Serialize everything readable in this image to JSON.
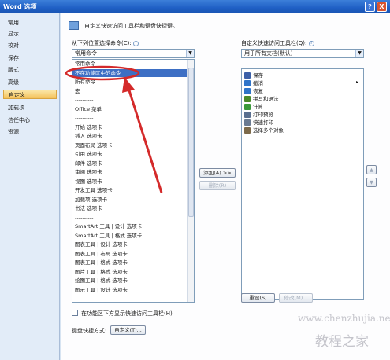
{
  "window": {
    "title": "Word 选项",
    "help_glyph": "?",
    "close_glyph": "X"
  },
  "sidebar": {
    "items": [
      {
        "label": "常用"
      },
      {
        "label": "显示"
      },
      {
        "label": "校对"
      },
      {
        "label": "保存"
      },
      {
        "label": "版式"
      },
      {
        "label": "高级"
      },
      {
        "label": "自定义",
        "active": true
      },
      {
        "label": "加载项"
      },
      {
        "label": "信任中心"
      },
      {
        "label": "资源"
      }
    ]
  },
  "main": {
    "header_text": "自定义快速访问工具栏和键盘快捷键。",
    "left_label": "从下列位置选择命令(C):",
    "left_dropdown_value": "常用命令",
    "right_label": "自定义快速访问工具栏(Q):",
    "right_dropdown_value": "用于所有文档(默认)",
    "commands_list": [
      "常用命令",
      "不在功能区中的命令",
      "所有命令",
      "宏",
      "----------",
      "Office 菜单",
      "----------",
      "开始 选项卡",
      "插入 选项卡",
      "页面布局 选项卡",
      "引用 选项卡",
      "邮件 选项卡",
      "审阅 选项卡",
      "视图 选项卡",
      "开发工具 选项卡",
      "加载项 选项卡",
      "书法 选项卡",
      "----------",
      "SmartArt 工具 | 设计 选项卡",
      "SmartArt 工具 | 格式 选项卡",
      "图表工具 | 设计 选项卡",
      "图表工具 | 布局 选项卡",
      "图表工具 | 格式 选项卡",
      "图片工具 | 格式 选项卡",
      "绘图工具 | 格式 选项卡",
      "图示工具 | 设计 选项卡"
    ],
    "selected_index": 1,
    "add_button": "添加(A) >>",
    "remove_button": "删除(R)",
    "qat_items": [
      {
        "label": "保存",
        "icon": "save-icon",
        "color": "#3b5fa8"
      },
      {
        "label": "撤消",
        "icon": "undo-icon",
        "color": "#2f74c9"
      },
      {
        "label": "恢复",
        "icon": "redo-icon",
        "color": "#2f74c9"
      },
      {
        "label": "拼写和语法",
        "icon": "spelling-icon",
        "color": "#4a8a2a"
      },
      {
        "label": "计算",
        "icon": "calculate-icon",
        "color": "#3a9a3a"
      },
      {
        "label": "打印预览",
        "icon": "print-preview-icon",
        "color": "#5a6f8f"
      },
      {
        "label": "快速打印",
        "icon": "quick-print-icon",
        "color": "#6b7b92"
      },
      {
        "label": "选择多个对象",
        "icon": "select-objects-icon",
        "color": "#7d6a4a"
      }
    ],
    "reset_button": "重设(S)",
    "modify_button": "修改(M)...",
    "show_below_checkbox": "在功能区下方显示快速访问工具栏(H)",
    "keyboard_label": "键盘快捷方式:",
    "customize_button": "自定义(T)...",
    "up_glyph": "▲",
    "down_glyph": "▼"
  },
  "watermark": {
    "line1": "www.chenzhujia.net",
    "line2": "教程之家"
  },
  "colors": {
    "selection": "#3d6fc4",
    "annotation_red": "#d42a2a",
    "active_sidebar": "#f4c25c"
  }
}
